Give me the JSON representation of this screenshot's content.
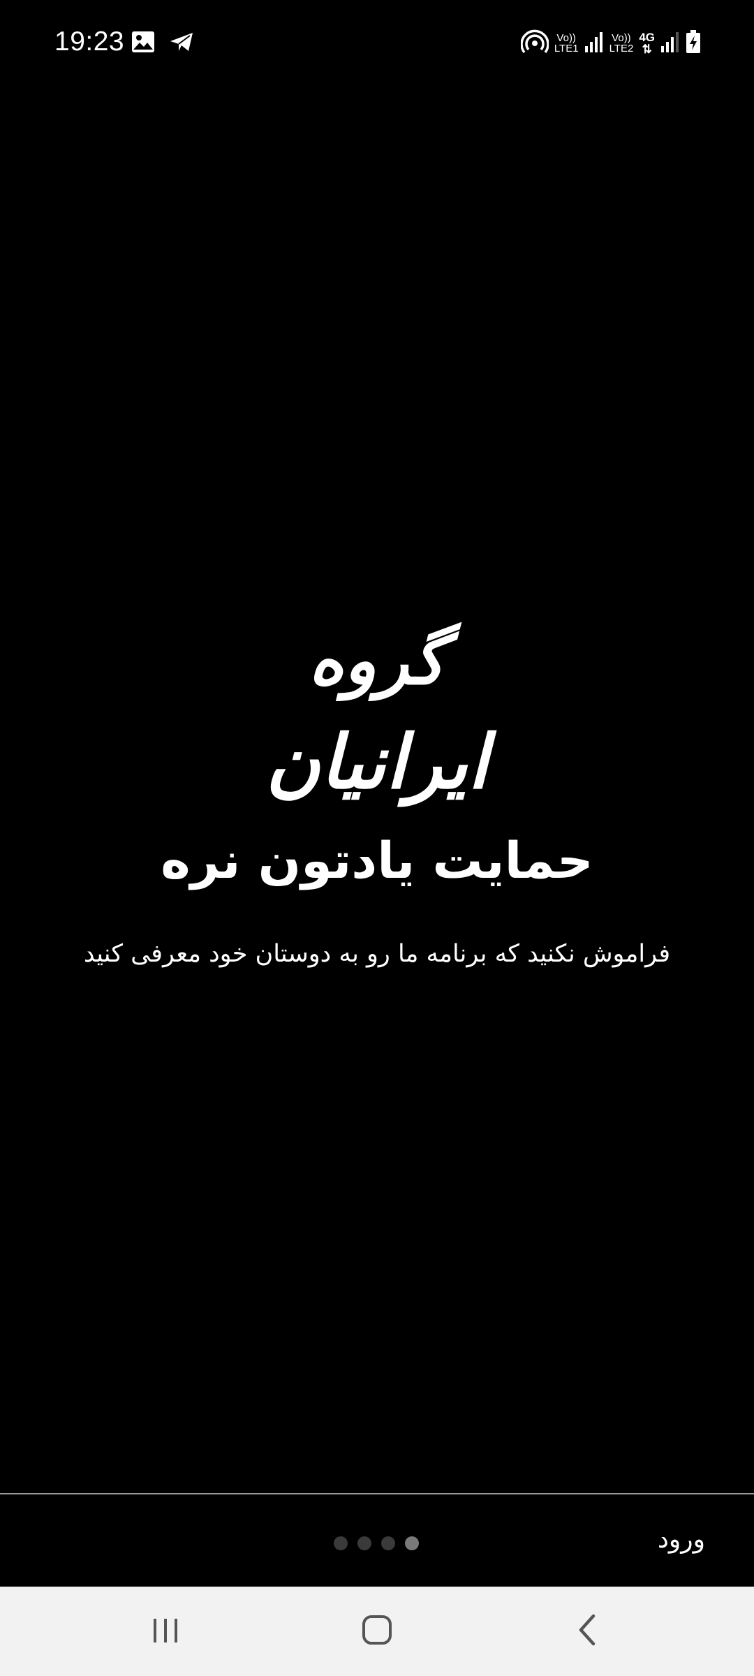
{
  "status_bar": {
    "time": "19:23",
    "icons": {
      "gallery": "image-icon",
      "telegram": "send-icon",
      "hotspot": "hotspot-icon",
      "battery": "battery-charging-icon"
    },
    "sim1": {
      "top": "Vo))",
      "bottom": "LTE1"
    },
    "sim2": {
      "top": "Vo))",
      "bottom": "LTE2"
    },
    "network": "4G"
  },
  "onboarding": {
    "title_line_1": "گروه",
    "title_line_2": "ایرانیان",
    "title_line_3": "حمایت یادتون نره",
    "subtitle": "فراموش نکنید که برنامه ما رو به دوستان خود معرفی کنید",
    "pages_total": 4,
    "active_page": 4
  },
  "bottom_bar": {
    "login_label": "ورود"
  },
  "nav_bar": {
    "recents": "recents-icon",
    "home": "home-icon",
    "back": "back-icon"
  },
  "colors": {
    "background": "#000000",
    "text": "#ffffff",
    "dot_inactive": "#3a3a3a",
    "dot_active": "#7a7a7a",
    "nav_bar": "#f2f2f2"
  }
}
